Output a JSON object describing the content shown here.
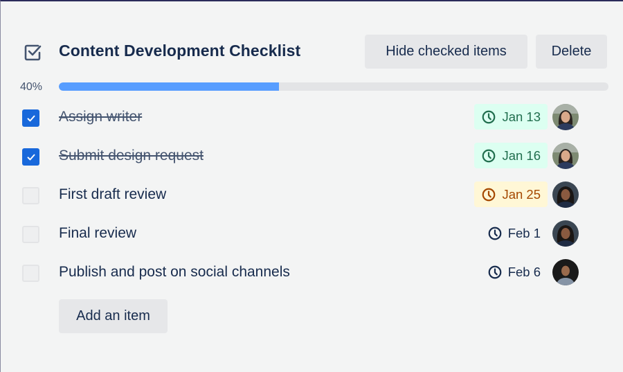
{
  "checklist": {
    "title": "Content Development Checklist",
    "icon": "checkbox-checked-icon",
    "hide_checked_label": "Hide checked items",
    "delete_label": "Delete",
    "progress": {
      "percent_label": "40%",
      "value": 40
    },
    "add_item_label": "Add an item",
    "colors": {
      "accent": "#1868db",
      "progress_fill": "#579dff",
      "due_done_bg": "#dcfff1",
      "due_done_text": "#216e4e",
      "due_soon_bg": "#fff7d6",
      "due_soon_text": "#a54800"
    },
    "items": [
      {
        "text": "Assign writer",
        "checked": true,
        "due": "Jan 13",
        "due_status": "done",
        "avatar": "avatar-woman-1"
      },
      {
        "text": "Submit design request",
        "checked": true,
        "due": "Jan 16",
        "due_status": "done",
        "avatar": "avatar-woman-1"
      },
      {
        "text": "First draft review",
        "checked": false,
        "due": "Jan 25",
        "due_status": "soon",
        "avatar": "avatar-woman-2"
      },
      {
        "text": "Final review",
        "checked": false,
        "due": "Feb 1",
        "due_status": "normal",
        "avatar": "avatar-woman-2"
      },
      {
        "text": "Publish and post on social channels",
        "checked": false,
        "due": "Feb 6",
        "due_status": "normal",
        "avatar": "avatar-man-1"
      }
    ]
  }
}
